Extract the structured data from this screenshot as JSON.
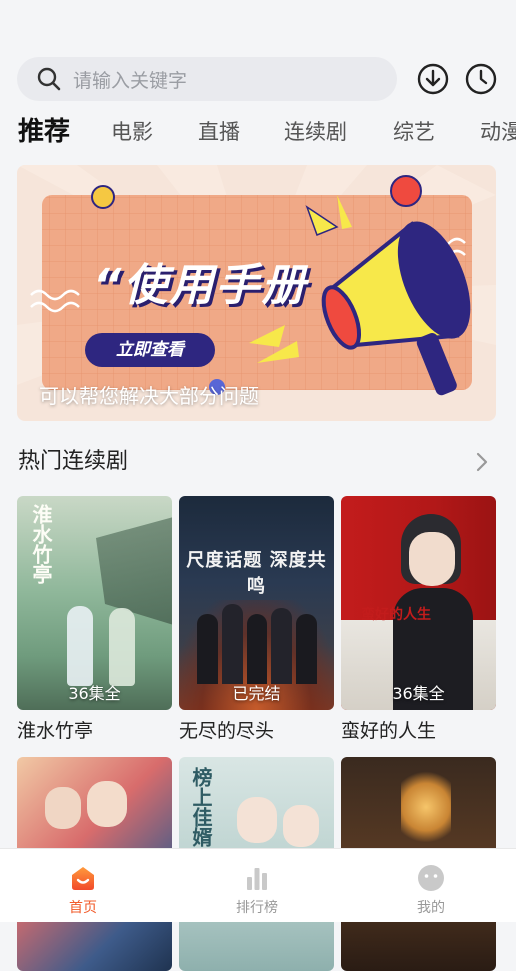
{
  "search": {
    "placeholder": "请输入关键字"
  },
  "tabs": [
    {
      "label": "推荐",
      "active": true
    },
    {
      "label": "电影"
    },
    {
      "label": "直播"
    },
    {
      "label": "连续剧"
    },
    {
      "label": "综艺"
    },
    {
      "label": "动漫"
    }
  ],
  "banner": {
    "title": "“使用手册",
    "button": "立即查看",
    "caption": "可以帮您解决大部分问题"
  },
  "section": {
    "title": "热门连续剧"
  },
  "cards": [
    {
      "name": "淮水竹亭",
      "badge": "36集全",
      "poster_text": "淮水竹亭"
    },
    {
      "name": "无尽的尽头",
      "badge": "已完结",
      "poster_text": "尺度话题 深度共鸣"
    },
    {
      "name": "蛮好的人生",
      "badge": "36集全",
      "poster_text": "蛮好的人生"
    },
    {
      "name": "",
      "badge": "",
      "poster_text": ""
    },
    {
      "name": "",
      "badge": "",
      "poster_text": "榜上佳婿"
    },
    {
      "name": "",
      "badge": "",
      "poster_text": ""
    }
  ],
  "tabbar": [
    {
      "label": "首页",
      "active": true
    },
    {
      "label": "排行榜"
    },
    {
      "label": "我的"
    }
  ],
  "colors": {
    "accent": "#f25b2a",
    "banner_bg": "#f0a987",
    "navy": "#2e2680"
  }
}
